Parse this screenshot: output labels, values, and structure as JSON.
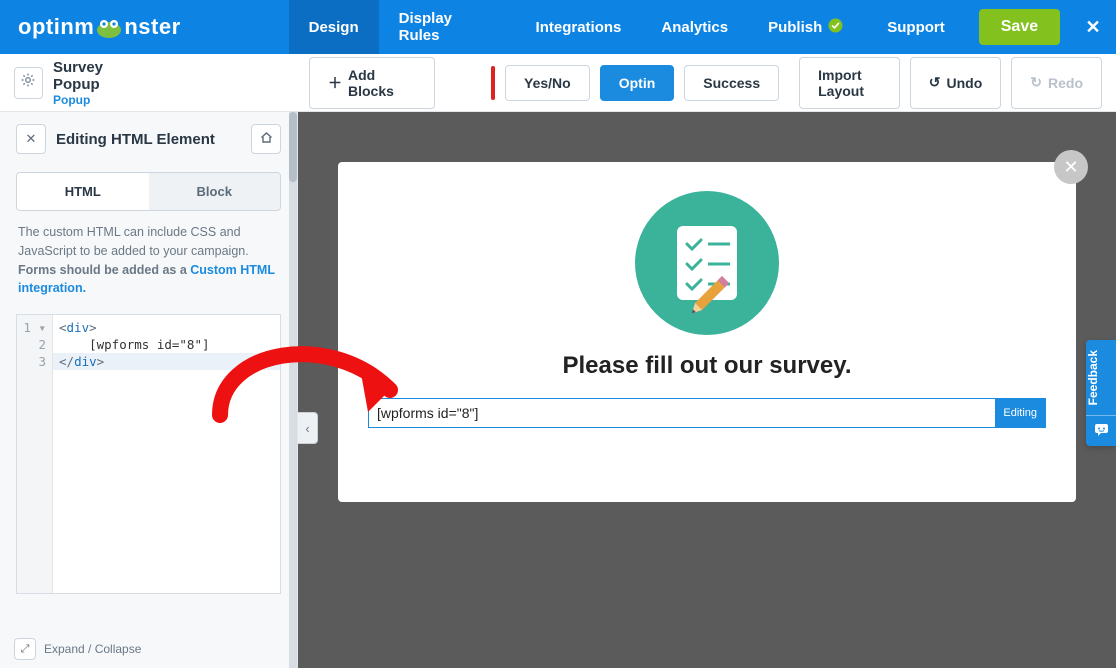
{
  "brand": "optinmonster",
  "nav": {
    "design": "Design",
    "display_rules": "Display Rules",
    "integrations": "Integrations",
    "analytics": "Analytics",
    "publish": "Publish"
  },
  "top_actions": {
    "support": "Support",
    "save": "Save"
  },
  "campaign": {
    "title": "Survey Popup",
    "type": "Popup"
  },
  "toolbar": {
    "add_blocks": "Add Blocks",
    "yes_no": "Yes/No",
    "optin": "Optin",
    "success": "Success",
    "import_layout": "Import Layout",
    "undo": "Undo",
    "redo": "Redo"
  },
  "panel": {
    "title": "Editing HTML Element",
    "tab_html": "HTML",
    "tab_block": "Block",
    "help_text": "The custom HTML can include CSS and JavaScript to be added to your campaign. ",
    "help_bold": "Forms should be added as a ",
    "help_link": "Custom HTML integration."
  },
  "code": {
    "line_numbers": [
      "1",
      "2",
      "3"
    ],
    "l1_open": "<",
    "l1_tag": "div",
    "l1_close": ">",
    "l2": "    [wpforms id=\"8\"]",
    "l3_open": "</",
    "l3_tag": "div",
    "l3_close": ">",
    "fold_marker": "▾"
  },
  "expand": "Expand / Collapse",
  "popup": {
    "title": "Please fill out our survey.",
    "shortcode": "[wpforms id=\"8\"]",
    "badge": "Editing"
  },
  "feedback": "Feedback"
}
